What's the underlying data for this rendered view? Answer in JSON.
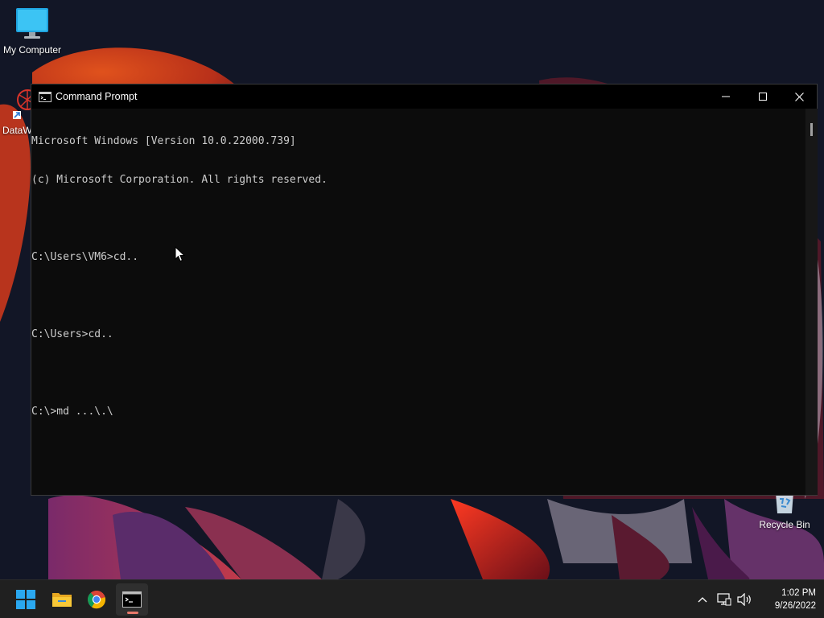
{
  "desktop": {
    "icons": [
      {
        "label": "My Computer",
        "icon": "monitor-icon"
      },
      {
        "label": "DataW",
        "icon": "datawarrior-shortcut-icon"
      },
      {
        "label": "Recycle Bin",
        "icon": "recycle-bin-icon"
      }
    ]
  },
  "window": {
    "title": "Command Prompt",
    "icon": "cmd-icon",
    "controls": {
      "minimize": "minimize-icon",
      "maximize": "maximize-icon",
      "close": "close-icon"
    }
  },
  "console": {
    "lines": [
      "Microsoft Windows [Version 10.0.22000.739]",
      "(c) Microsoft Corporation. All rights reserved.",
      "",
      "C:\\Users\\VM6>cd..",
      "",
      "C:\\Users>cd..",
      "",
      "C:\\>md ...\\.\\"
    ],
    "text_color": "#cccccc",
    "background": "#0c0c0c"
  },
  "taskbar": {
    "apps": [
      {
        "name": "Start",
        "icon": "windows-start-icon"
      },
      {
        "name": "File Explorer",
        "icon": "folder-icon"
      },
      {
        "name": "Google Chrome",
        "icon": "chrome-icon"
      },
      {
        "name": "Command Prompt",
        "icon": "cmd-icon",
        "active": true
      }
    ],
    "tray": {
      "icons": [
        "chevron-up-icon",
        "network-icon",
        "volume-icon"
      ],
      "time": "1:02 PM",
      "date": "9/26/2022"
    },
    "accent": "#e8796b"
  }
}
